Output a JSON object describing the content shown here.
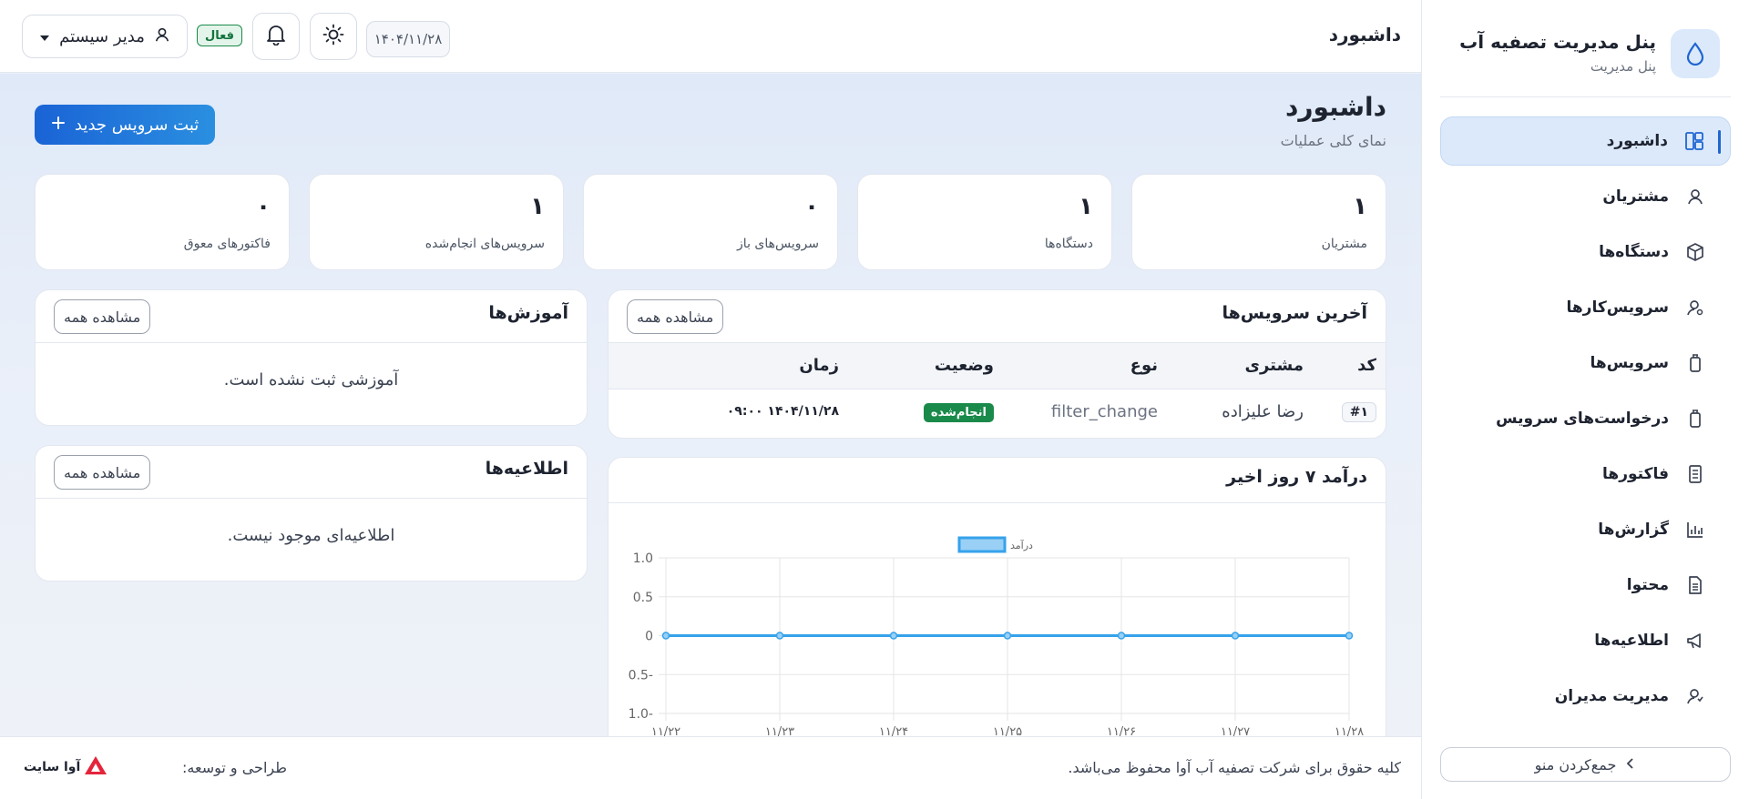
{
  "sidebar": {
    "brand_title": "پنل مدیریت تصفیه آب",
    "brand_subtitle": "پنل مدیریت",
    "items": [
      {
        "label": "داشبورد",
        "icon": "dashboard-icon"
      },
      {
        "label": "مشتریان",
        "icon": "user-icon"
      },
      {
        "label": "دستگاه‌ها",
        "icon": "box-icon"
      },
      {
        "label": "سرویس‌کارها",
        "icon": "technician-icon"
      },
      {
        "label": "سرویس‌ها",
        "icon": "filter-icon"
      },
      {
        "label": "درخواست‌های سرویس",
        "icon": "filter-icon"
      },
      {
        "label": "فاکتورها",
        "icon": "invoice-icon"
      },
      {
        "label": "گزارش‌ها",
        "icon": "chart-icon"
      },
      {
        "label": "محتوا",
        "icon": "document-icon"
      },
      {
        "label": "اطلاعیه‌ها",
        "icon": "megaphone-icon"
      },
      {
        "label": "مدیریت مدیران",
        "icon": "admin-icon"
      }
    ],
    "collapse_label": "جمع‌کردن منو"
  },
  "topbar": {
    "title": "داشبورد",
    "date": "۱۴۰۴/۱۱/۲۸",
    "status": "فعال",
    "user": "مدیر سیستم"
  },
  "main": {
    "title": "داشبورد",
    "subtitle": "نمای کلی عملیات",
    "new_service_label": "ثبت سرویس جدید",
    "stats": [
      {
        "value": "۱",
        "label": "مشتریان"
      },
      {
        "value": "۱",
        "label": "دستگاه‌ها"
      },
      {
        "value": "۰",
        "label": "سرویس‌های باز"
      },
      {
        "value": "۱",
        "label": "سرویس‌های انجام‌شده"
      },
      {
        "value": "۰",
        "label": "فاکتورهای معوق"
      }
    ],
    "recent_services": {
      "title": "آخرین سرویس‌ها",
      "view_all": "مشاهده همه",
      "columns": [
        "کد",
        "مشتری",
        "نوع",
        "وضعیت",
        "زمان"
      ],
      "rows": [
        {
          "code": "#۱",
          "customer": "رضا علیزاده",
          "type": "filter_change",
          "status": "انجام‌شده",
          "time": "۱۴۰۴/۱۱/۲۸ ۰۹:۰۰"
        }
      ]
    },
    "trainings": {
      "title": "آموزش‌ها",
      "view_all": "مشاهده همه",
      "empty": "آموزشی ثبت نشده است."
    },
    "announcements": {
      "title": "اطلاعیه‌ها",
      "view_all": "مشاهده همه",
      "empty": "اطلاعیه‌ای موجود نیست."
    },
    "revenue": {
      "title": "درآمد ۷ روز اخیر"
    }
  },
  "chart_data": {
    "type": "line",
    "categories": [
      "۱۱/۲۲",
      "۱۱/۲۳",
      "۱۱/۲۴",
      "۱۱/۲۵",
      "۱۱/۲۶",
      "۱۱/۲۷",
      "۱۱/۲۸"
    ],
    "series": [
      {
        "name": "درآمد",
        "values": [
          0,
          0,
          0,
          0,
          0,
          0,
          0
        ],
        "color": "#36a2eb"
      }
    ],
    "ylim": [
      -1,
      1
    ],
    "yticks": [
      1,
      0.5,
      0,
      -0.5,
      -1
    ],
    "ytick_labels": [
      "1.0",
      "0.5",
      "0",
      "0.5-",
      "1.0-"
    ],
    "grid": true,
    "legend": "top-center"
  },
  "footer": {
    "copyright": "کلیه حقوق برای شرکت تصفیه آب آوا محفوظ می‌باشد.",
    "developer_label": "طراحی و توسعه:",
    "developer_logo_text": "آوا سایت"
  },
  "colors": {
    "primary": "#1f66d1",
    "success": "#1a8a4a",
    "chart_line": "#36a2eb"
  }
}
